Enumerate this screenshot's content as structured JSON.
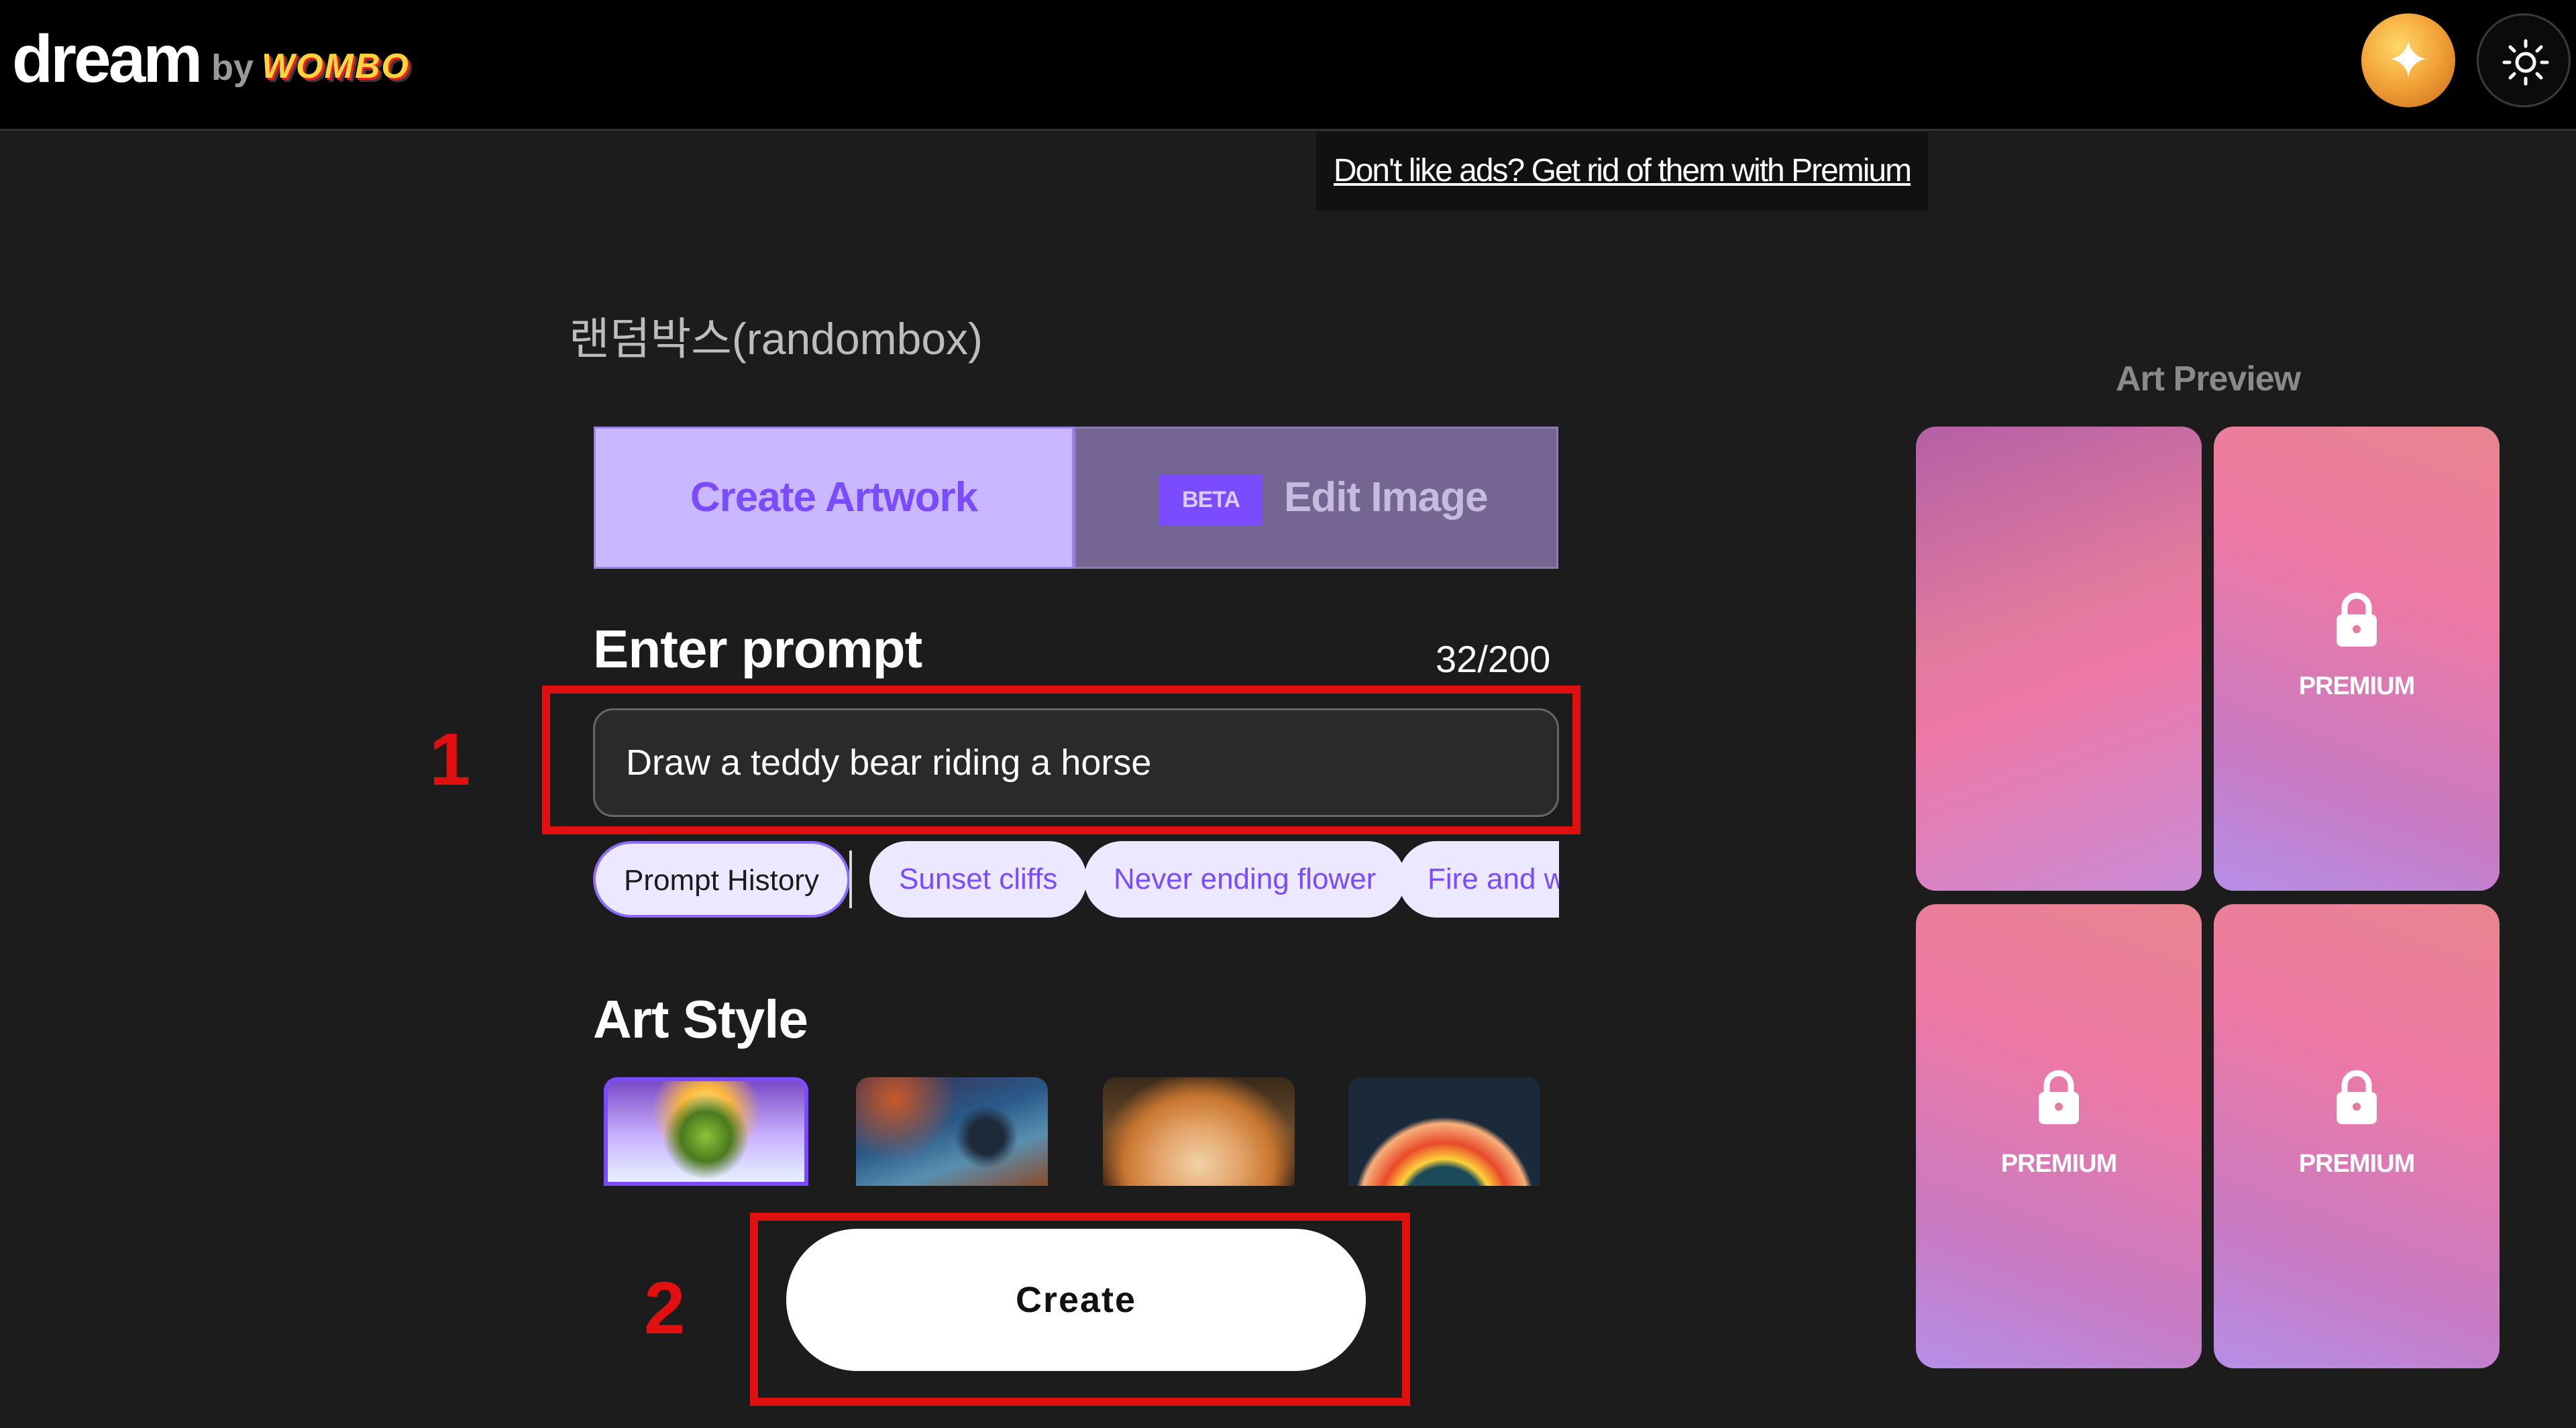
{
  "header": {
    "logo": "dream",
    "logo_by": "by",
    "logo_brand": "WOMBO"
  },
  "ad": {
    "text": "Don't like ads? Get rid of them with Premium"
  },
  "room_title": "랜덤박스(randombox)",
  "tabs": {
    "create": "Create Artwork",
    "beta_badge": "BETA",
    "edit": "Edit Image"
  },
  "prompt": {
    "heading": "Enter prompt",
    "counter": "32/200",
    "value": "Draw a teddy bear riding a horse"
  },
  "chips": {
    "history": "Prompt History",
    "suggestions": [
      "Sunset cliffs",
      "Never ending flower",
      "Fire and water"
    ]
  },
  "art_style": {
    "heading": "Art Style"
  },
  "create_button": "Create",
  "annotations": {
    "one": "1",
    "two": "2"
  },
  "preview": {
    "heading": "Art Preview",
    "premium_label": "PREMIUM"
  },
  "colors": {
    "accent": "#7a4bff",
    "highlight": "#e01010",
    "background": "#1c1c1c"
  }
}
